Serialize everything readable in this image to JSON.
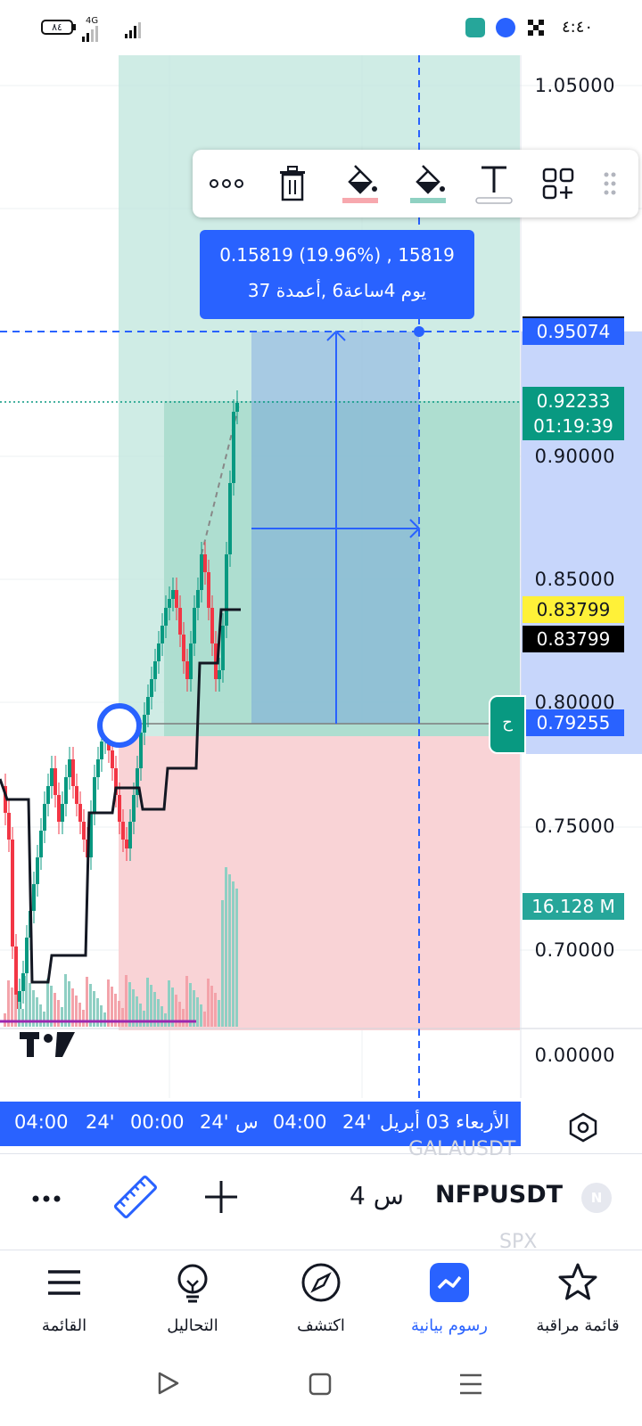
{
  "status_bar": {
    "time": "٤:٤٠",
    "battery": "٨٤",
    "network": "4G"
  },
  "price_axis": {
    "labels": [
      "1.05000",
      "0.90000",
      "0.85000",
      "0.80000",
      "0.75000",
      "0.70000",
      "0.00000"
    ],
    "tags": {
      "measure_top": "0.95074",
      "last_price": "0.92233",
      "countdown": "01:19:39",
      "yellow_level": "0.83799",
      "black_level": "0.83799",
      "measure_bottom": "0.79255",
      "volume": "16.128 M"
    }
  },
  "measure": {
    "line1": "0.15819 (19.96%) , 15819",
    "line2": "يوم 4ساعة6 ,أعمدة 37"
  },
  "toolbar": {
    "items": [
      "more-icon",
      "trash-icon",
      "fill-color-icon",
      "fill-color-icon",
      "text-icon",
      "add-template-icon",
      "drag-handle-icon"
    ]
  },
  "side_handle": "ح",
  "time_axis": {
    "labels": [
      "04:00",
      "24'",
      "00:00",
      "24'",
      "س",
      "04:00",
      "24'",
      "الأربعاء 03 أبريل"
    ]
  },
  "symbol_bar": {
    "symbol": "NFPUSDT",
    "badge": "N",
    "interval_value": "4",
    "interval_unit": "س",
    "ghost_above": "GALAUSDT",
    "ghost_below": "SPX"
  },
  "bottom_nav": [
    {
      "label": "القائمة",
      "icon": "menu-icon"
    },
    {
      "label": "التحاليل",
      "icon": "idea-icon"
    },
    {
      "label": "اكتشف",
      "icon": "compass-icon"
    },
    {
      "label": "رسوم بيانية",
      "icon": "chart-icon"
    },
    {
      "label": "قائمة مراقبة",
      "icon": "star-icon"
    }
  ],
  "colors": {
    "accent": "#2962ff",
    "up": "#089981",
    "down": "#f23645",
    "profit_zone": "#bfe6dc",
    "loss_zone": "#f9d3d6",
    "yellow_tag": "#fff138"
  }
}
